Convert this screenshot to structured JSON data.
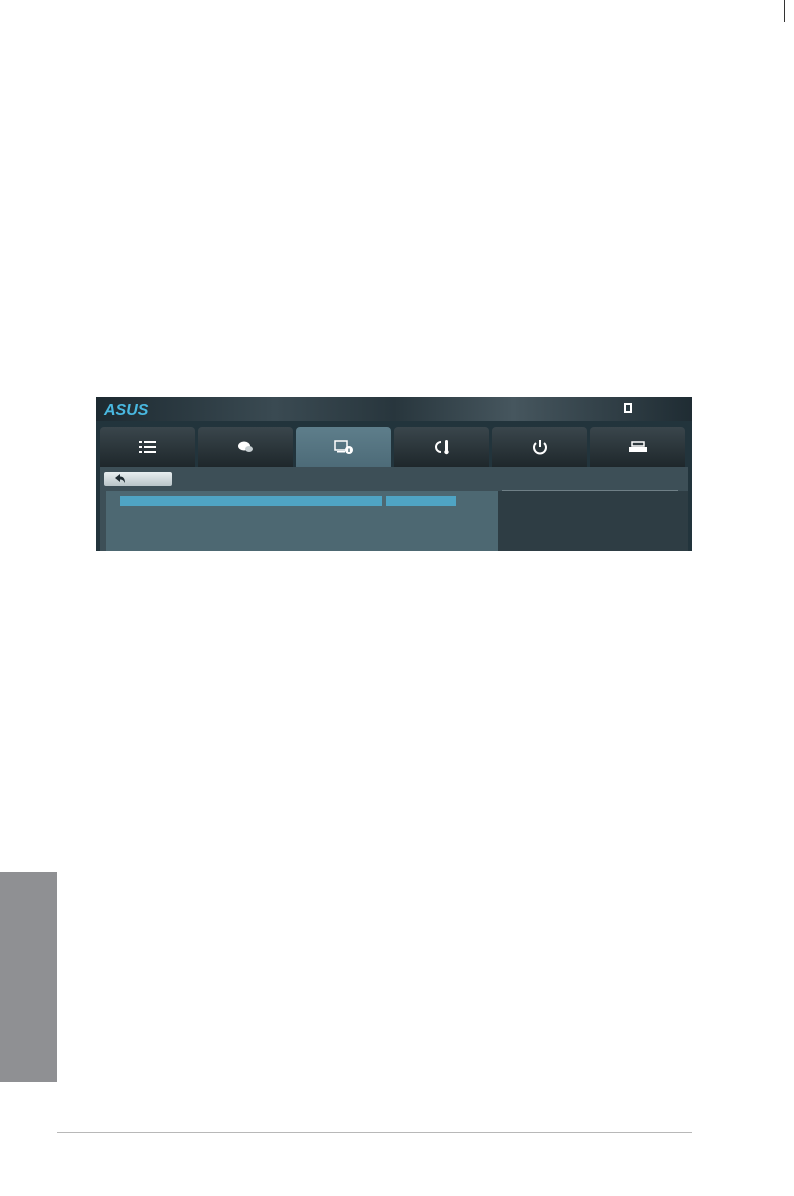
{
  "colors": {
    "chapter_tab": "#8f9093",
    "bios_background": "#22343c",
    "active_tab": "#5e7e8b",
    "highlight": "#4fa4c4",
    "main_panel": "#4d6872",
    "help_panel": "#2e3d44"
  },
  "bios": {
    "logo": "ASUS",
    "header_icons": [
      "exit-icon"
    ],
    "tabs": [
      {
        "icon": "list-icon",
        "active": false
      },
      {
        "icon": "chat-icon",
        "active": false
      },
      {
        "icon": "monitor-info-icon",
        "active": true
      },
      {
        "icon": "fan-temp-icon",
        "active": false
      },
      {
        "icon": "power-icon",
        "active": false
      },
      {
        "icon": "drive-icon",
        "active": false
      }
    ],
    "back_icon": "back-arrow-icon"
  }
}
